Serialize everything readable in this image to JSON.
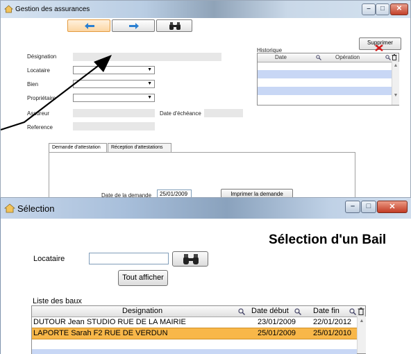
{
  "win1": {
    "title": "Gestion des assurances",
    "nav": {
      "prev_icon": "arrow-left-icon",
      "next_icon": "arrow-right-icon",
      "search_icon": "binoculars-icon"
    },
    "delete_label": "Supprimer",
    "fields": {
      "designation": "Désignation",
      "locataire": "Locataire",
      "bien": "Bien",
      "proprietaire": "Propriétaire",
      "assureur": "Assureur",
      "date_echeance": "Date d'échéance",
      "reference": "Reference"
    },
    "historique": {
      "label": "Historique",
      "col_date": "Date",
      "col_operation": "Opération"
    },
    "tabs": [
      "Demande d'attestation",
      "Réception d'attestations"
    ],
    "date_demande_label": "Date de la demande",
    "date_demande_value": "25/01/2009",
    "print_button": "Imprimer la demande"
  },
  "win2": {
    "title": "Sélection",
    "heading": "Sélection d'un Bail",
    "locataire_label": "Locataire",
    "locataire_value": "",
    "show_all": "Tout afficher",
    "list_label": "Liste des baux",
    "columns": [
      "Designation",
      "Date début",
      "Date fin"
    ],
    "rows": [
      {
        "designation": "DUTOUR Jean STUDIO RUE DE LA MAIRIE",
        "debut": "23/01/2009",
        "fin": "22/01/2012"
      },
      {
        "designation": "LAPORTE Sarah F2 RUE DE VERDUN",
        "debut": "25/01/2009",
        "fin": "25/01/2010"
      }
    ]
  },
  "colors": {
    "selection": "#f8b749",
    "accent": "#fcd6a3",
    "band": "#c8d7f5"
  }
}
